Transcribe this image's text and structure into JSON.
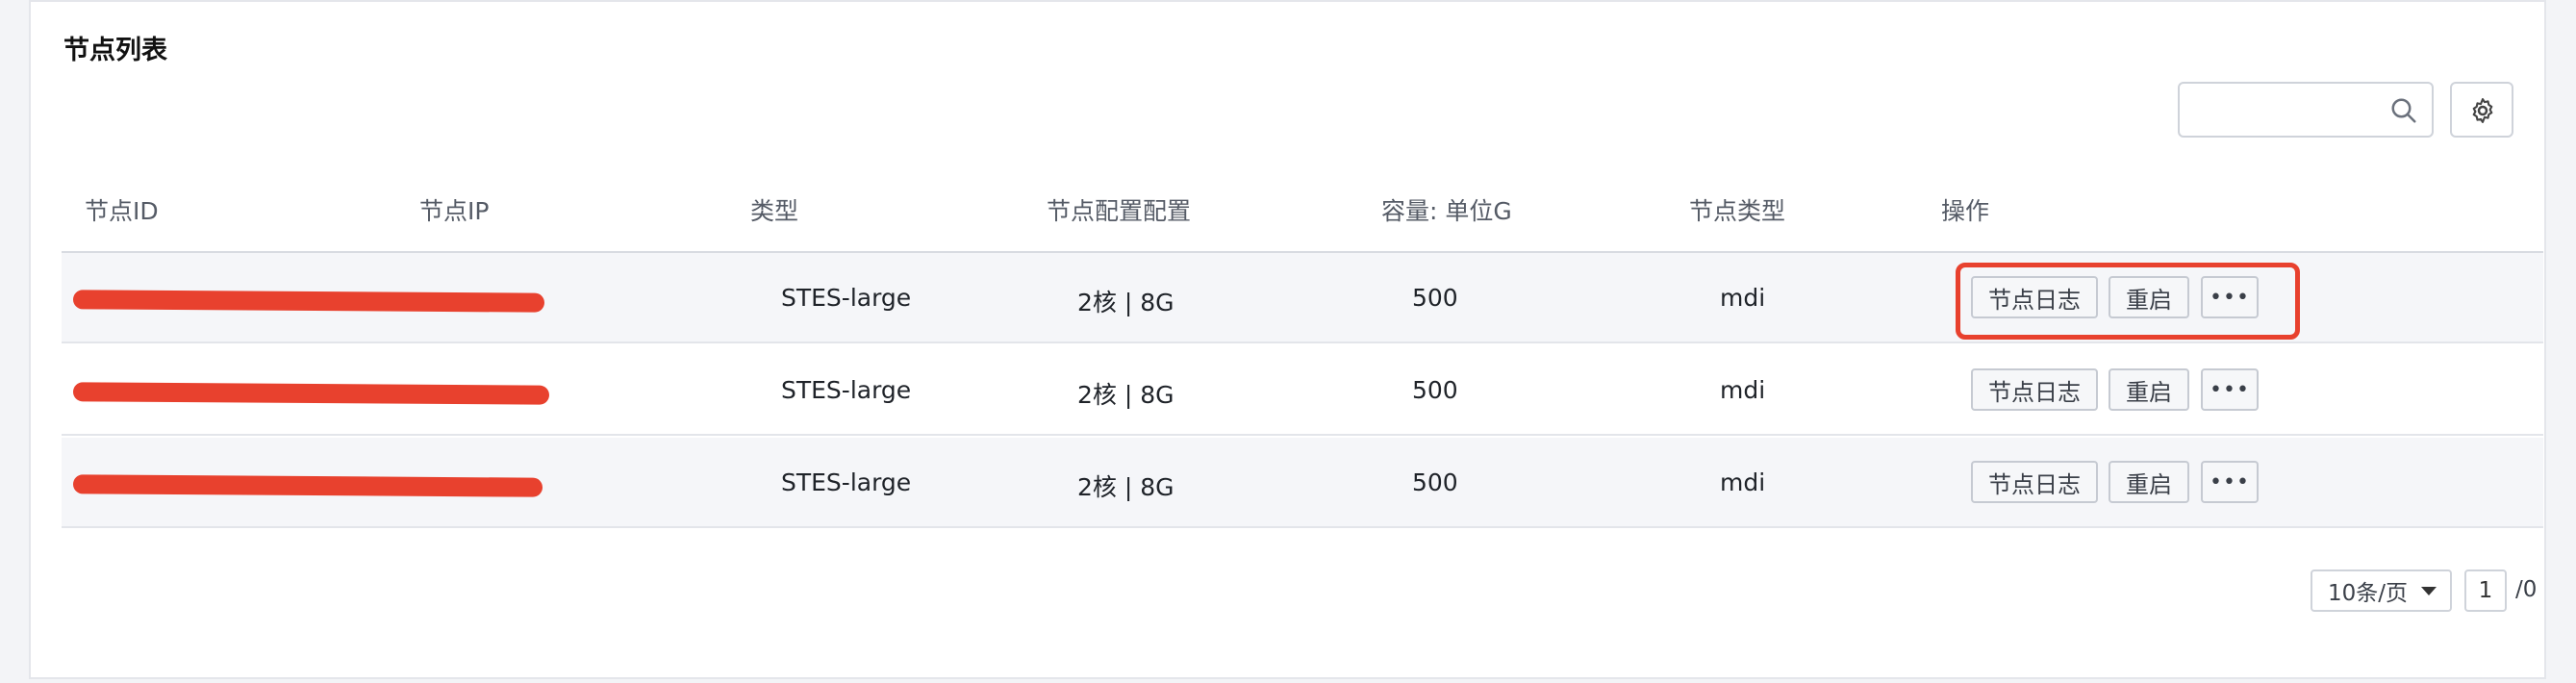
{
  "panel": {
    "title": "节点列表"
  },
  "search": {
    "placeholder": ""
  },
  "table": {
    "headers": [
      "节点ID",
      "节点IP",
      "类型",
      "节点配置配置",
      "容量: 单位G",
      "节点类型",
      "操作"
    ],
    "rows": [
      {
        "node_id": "[redacted]",
        "node_ip": "[redacted]",
        "type": "STES-large",
        "config": "2核 | 8G",
        "capacity": "500",
        "node_type": "mdi"
      },
      {
        "node_id": "[redacted]",
        "node_ip": "[redacted]",
        "type": "STES-large",
        "config": "2核 | 8G",
        "capacity": "500",
        "node_type": "mdi"
      },
      {
        "node_id": "[redacted]",
        "node_ip": "[redacted]",
        "type": "STES-large",
        "config": "2核 | 8G",
        "capacity": "500",
        "node_type": "mdi"
      }
    ],
    "actions": {
      "log": "节点日志",
      "restart": "重启",
      "more": "•••"
    }
  },
  "pagination": {
    "page_size": "10条/页",
    "current_page": "1",
    "total": "/0"
  },
  "colors": {
    "highlight": "#e8412e",
    "redaction": "#e8412e"
  },
  "icons": {
    "search": "search-icon",
    "settings": "gear-icon",
    "dropdown": "caret-down-icon"
  }
}
